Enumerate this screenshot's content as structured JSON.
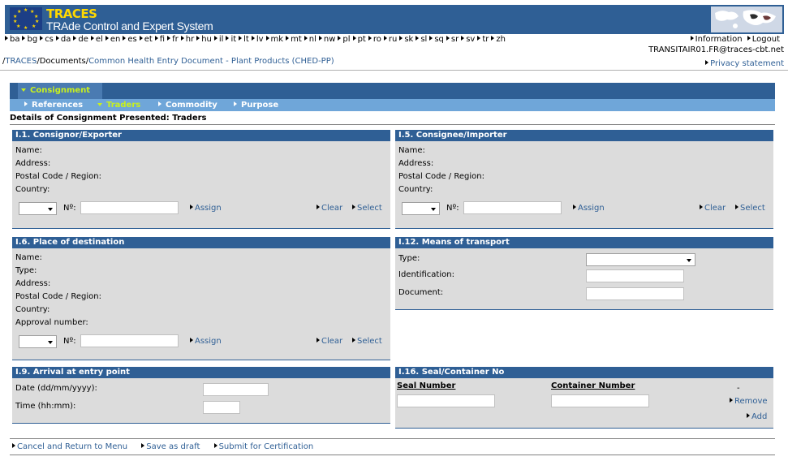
{
  "app": {
    "title": "TRACES",
    "subtitle": "TRAde Control and Expert System"
  },
  "languages": [
    "ba",
    "bg",
    "cs",
    "da",
    "de",
    "el",
    "en",
    "es",
    "et",
    "fi",
    "fr",
    "hr",
    "hu",
    "il",
    "it",
    "lt",
    "lv",
    "mk",
    "mt",
    "nl",
    "nw",
    "pl",
    "pt",
    "ro",
    "ru",
    "sk",
    "sl",
    "sq",
    "sr",
    "sv",
    "tr",
    "zh"
  ],
  "topnav": {
    "information": "Information",
    "logout": "Logout",
    "user": "TRANSITAIR01.FR@traces-cbt.net"
  },
  "breadcrumb": {
    "sep": "/",
    "traces": "TRACES",
    "documents": "Documents",
    "current": "Common Health Entry Document - Plant Products (CHED-PP)"
  },
  "privacy": "Privacy statement",
  "tabs": {
    "main": "Consignment",
    "sub": [
      "References",
      "Traders",
      "Commodity",
      "Purpose"
    ]
  },
  "details_title": "Details of Consignment Presented: Traders",
  "panels": {
    "consignor": {
      "title": "I.1. Consignor/Exporter",
      "fields": [
        "Name:",
        "Address:",
        "Postal Code / Region:",
        "Country:"
      ]
    },
    "consignee": {
      "title": "I.5. Consignee/Importer",
      "fields": [
        "Name:",
        "Address:",
        "Postal Code / Region:",
        "Country:"
      ]
    },
    "destination": {
      "title": "I.6. Place of destination",
      "fields": [
        "Name:",
        "Type:",
        "Address:",
        "Postal Code / Region:",
        "Country:",
        "Approval number:"
      ]
    },
    "transport": {
      "title": "I.12. Means of transport",
      "type_label": "Type:",
      "identification_label": "Identification:",
      "document_label": "Document:"
    },
    "arrival": {
      "title": "I.9. Arrival at entry point",
      "date_label": "Date (dd/mm/yyyy):",
      "time_label": "Time (hh:mm):"
    },
    "seal": {
      "title": "I.16. Seal/Container No",
      "seal_header": "Seal Number",
      "container_header": "Container Number",
      "dash": "-",
      "remove": "Remove",
      "add": "Add"
    }
  },
  "controls": {
    "no_label": "Nº:",
    "assign": "Assign",
    "clear": "Clear",
    "select": "Select"
  },
  "bottom": {
    "cancel": "Cancel and Return to Menu",
    "save": "Save as draft",
    "submit": "Submit for Certification"
  },
  "colors": {
    "header_blue": "#2f5f95",
    "subtab_blue": "#6fa6d9",
    "accent_yellow": "#c8f01e",
    "panel_gray": "#dcdcdc"
  }
}
